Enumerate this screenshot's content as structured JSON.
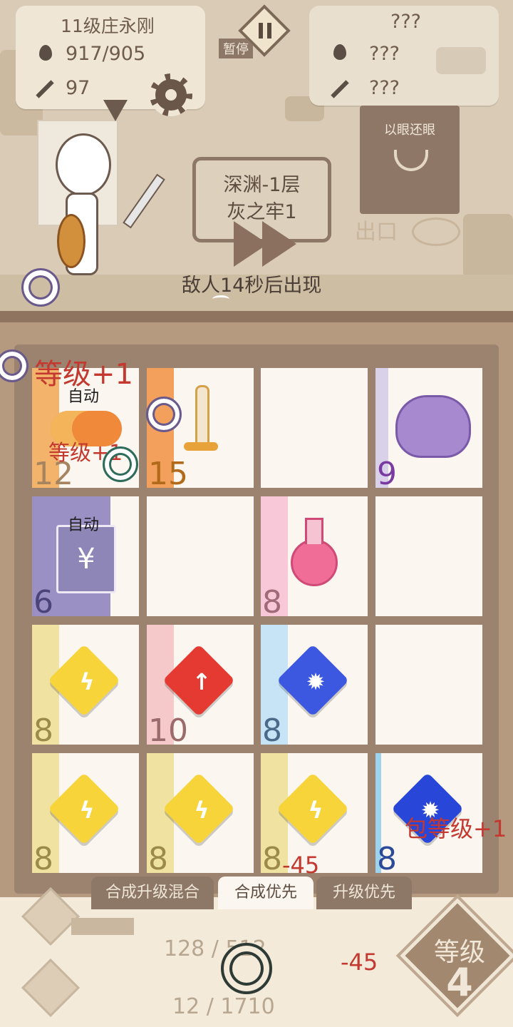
{
  "player": {
    "name": "11级庄永刚",
    "hp": "917/905",
    "atk": "97"
  },
  "pause_label": "暂停",
  "enemy": {
    "name": "???",
    "hp": "???",
    "atk": "???",
    "skill": "以眼还眼"
  },
  "stage": {
    "line1": "深渊-1层",
    "line2": "灰之牢1"
  },
  "exit_label": "出口",
  "timer": "敌人14秒后出现",
  "board": {
    "cells": [
      {
        "row": 0,
        "col": 0,
        "num": "12",
        "auto": "自动",
        "strip": "#f4b36b",
        "numcolor": "#a5845f",
        "item": "food"
      },
      {
        "row": 0,
        "col": 1,
        "num": "15",
        "auto": "",
        "strip": "#f2a05c",
        "numcolor": "#b06a1a",
        "item": "sword"
      },
      {
        "row": 0,
        "col": 2,
        "num": "",
        "auto": "",
        "strip": "",
        "numcolor": "",
        "item": "empty"
      },
      {
        "row": 0,
        "col": 3,
        "num": "9",
        "auto": "",
        "strip": "#d9d0ea",
        "numcolor": "#7b3aa2",
        "item": "slime"
      },
      {
        "row": 1,
        "col": 0,
        "num": "6",
        "auto": "自动",
        "strip": "#9b90c4",
        "numcolor": "#4a447a",
        "item": "money"
      },
      {
        "row": 1,
        "col": 1,
        "num": "",
        "auto": "",
        "strip": "",
        "numcolor": "",
        "item": "empty"
      },
      {
        "row": 1,
        "col": 2,
        "num": "8",
        "auto": "",
        "strip": "#f8c7d8",
        "numcolor": "#a06a78",
        "item": "potion"
      },
      {
        "row": 1,
        "col": 3,
        "num": "",
        "auto": "",
        "strip": "",
        "numcolor": "",
        "item": "empty"
      },
      {
        "row": 2,
        "col": 0,
        "num": "8",
        "auto": "",
        "strip": "#f0e2a1",
        "numcolor": "#9b8a4a",
        "item": "yellow"
      },
      {
        "row": 2,
        "col": 1,
        "num": "10",
        "auto": "",
        "strip": "#f5c9c9",
        "numcolor": "#9b6a6a",
        "item": "red"
      },
      {
        "row": 2,
        "col": 2,
        "num": "8",
        "auto": "",
        "strip": "#c7e3f6",
        "numcolor": "#4a6a8a",
        "item": "blue"
      },
      {
        "row": 2,
        "col": 3,
        "num": "",
        "auto": "",
        "strip": "",
        "numcolor": "",
        "item": "empty"
      },
      {
        "row": 3,
        "col": 0,
        "num": "8",
        "auto": "",
        "strip": "#f0e2a1",
        "numcolor": "#9b8a4a",
        "item": "yellow"
      },
      {
        "row": 3,
        "col": 1,
        "num": "8",
        "auto": "",
        "strip": "#f0e2a1",
        "numcolor": "#9b8a4a",
        "item": "yellow"
      },
      {
        "row": 3,
        "col": 2,
        "num": "8",
        "auto": "",
        "strip": "#f0e2a1",
        "numcolor": "#9b8a4a",
        "item": "yellow"
      },
      {
        "row": 3,
        "col": 3,
        "num": "8",
        "auto": "",
        "strip": "#9cd3ef",
        "numcolor": "#2b4a9a",
        "item": "blue2"
      }
    ]
  },
  "floats": {
    "level_big": "等级+1",
    "level_small": "等级+1",
    "bag_level": "包等级+1",
    "dmg1": "-45",
    "dmg2": "-45"
  },
  "tabs": [
    "合成升级混合",
    "合成优先",
    "升级优先"
  ],
  "bottom": {
    "count1": "128 / 512",
    "count2": "12 / 1710",
    "level_label": "等级",
    "level_num": "4"
  },
  "colors": {
    "yellow_gem": "#f6d43a",
    "red_gem": "#e53a32",
    "blue_gem": "#3d58e0",
    "blue_gem_dark": "#2846d8"
  }
}
